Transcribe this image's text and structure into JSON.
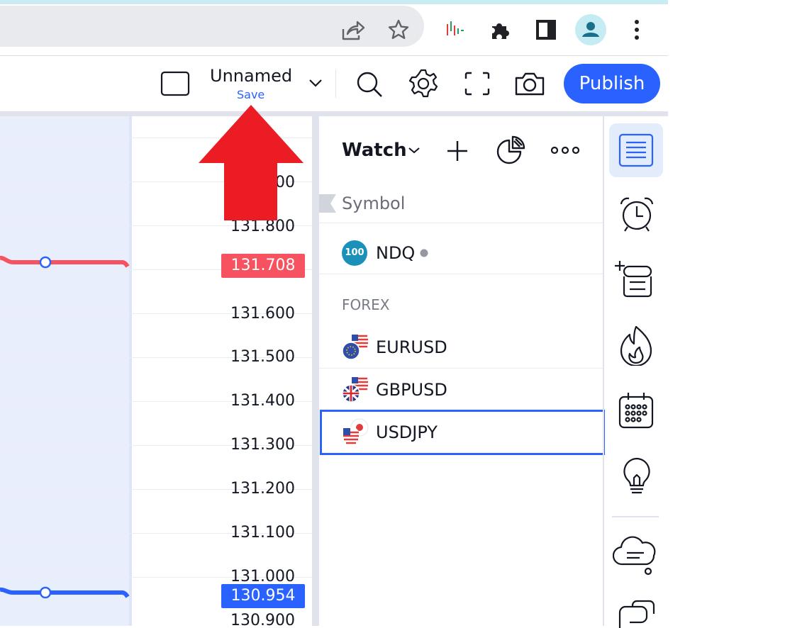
{
  "browser": {
    "icons": [
      "share-icon",
      "star-icon",
      "extension-tv-icon",
      "puzzle-icon",
      "sidepanel-icon",
      "profile-icon",
      "kebab-icon"
    ]
  },
  "header": {
    "layout_name": "Unnamed",
    "save_label": "Save",
    "publish_label": "Publish",
    "icons": [
      "layout-square-icon",
      "chevron-down-icon",
      "search-icon",
      "gear-icon",
      "fullscreen-icon",
      "camera-icon"
    ]
  },
  "chart": {
    "prices": [
      "131.800",
      "131.600",
      "131.500",
      "131.400",
      "131.300",
      "131.200",
      "131.100",
      "131.000",
      "130.900"
    ],
    "partial_price": "00",
    "red_tag": "131.708",
    "blue_tag": "130.954",
    "colors": {
      "red": "#f7525f",
      "blue": "#2962ff",
      "arrow": "#ec1c24"
    }
  },
  "watchlist": {
    "title": "Watch",
    "column_header": "Symbol",
    "ndq": {
      "badge": "100",
      "symbol": "NDQ"
    },
    "section": "FOREX",
    "forex": [
      {
        "symbol": "EURUSD"
      },
      {
        "symbol": "GBPUSD"
      },
      {
        "symbol": "USDJPY"
      }
    ]
  },
  "sidebar": {
    "icons": [
      "watchlist-icon",
      "alarm-clock-icon",
      "add-list-icon",
      "hot-list-icon",
      "calendar-icon",
      "lightbulb-icon",
      "chat-bubble-icon",
      "chats-icon"
    ]
  }
}
